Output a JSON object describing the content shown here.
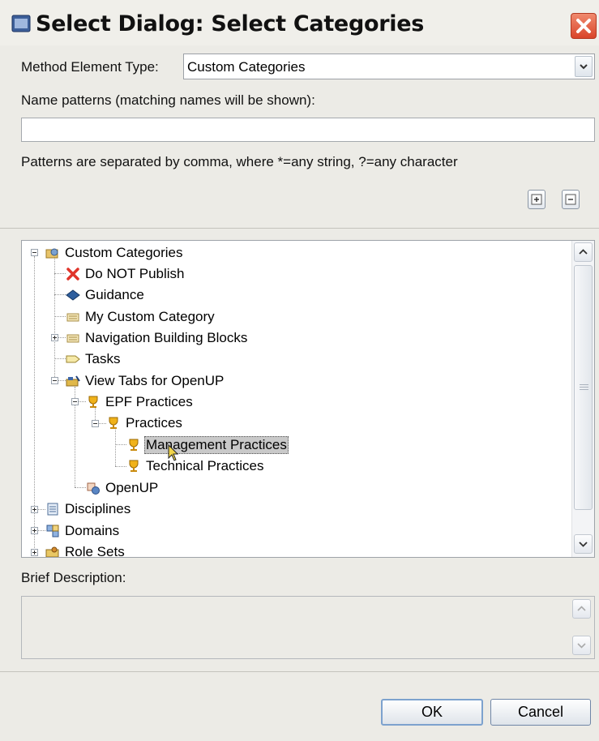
{
  "window": {
    "title": "Select Dialog: Select Categories"
  },
  "form": {
    "method_label": "Method Element Type:",
    "method_value": "Custom Categories",
    "patterns_label": "Name patterns (matching names will be shown):",
    "patterns_value": "",
    "patterns_hint": "Patterns are separated by comma, where *=any string, ?=any character"
  },
  "tree": {
    "nodes": [
      {
        "label": "Custom Categories",
        "icon": "custom-categories-icon"
      },
      {
        "label": "Do NOT Publish",
        "icon": "red-x-icon"
      },
      {
        "label": "Guidance",
        "icon": "guidance-book-icon"
      },
      {
        "label": "My Custom Category",
        "icon": "folder-icon"
      },
      {
        "label": "Navigation Building Blocks",
        "icon": "folder-icon"
      },
      {
        "label": "Tasks",
        "icon": "tasks-tag-icon"
      },
      {
        "label": "View Tabs for OpenUP",
        "icon": "view-tabs-icon"
      },
      {
        "label": "EPF Practices",
        "icon": "trophy-icon"
      },
      {
        "label": "Practices",
        "icon": "trophy-icon"
      },
      {
        "label": "Management Practices",
        "icon": "trophy-icon",
        "selected": true
      },
      {
        "label": "Technical Practices",
        "icon": "trophy-icon"
      },
      {
        "label": "OpenUP",
        "icon": "process-icon"
      },
      {
        "label": "Disciplines",
        "icon": "disciplines-icon"
      },
      {
        "label": "Domains",
        "icon": "domains-icon"
      },
      {
        "label": "Role Sets",
        "icon": "role-sets-icon"
      }
    ]
  },
  "description": {
    "label": "Brief Description:",
    "value": ""
  },
  "buttons": {
    "ok": "OK",
    "cancel": "Cancel"
  },
  "colors": {
    "selection": "#c9c9c9",
    "close": "#d9452a",
    "dialog_bg": "#ecebe6"
  }
}
